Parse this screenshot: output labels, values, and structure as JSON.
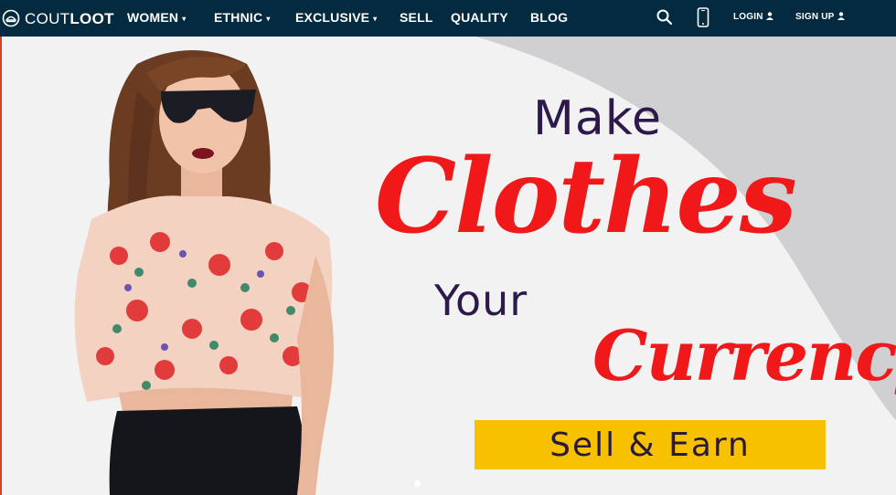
{
  "brand": {
    "thin": "COUT",
    "bold": "LOOT"
  },
  "nav": {
    "items": [
      {
        "label": "WOMEN",
        "caret": "▾"
      },
      {
        "label": "ETHNIC",
        "caret": "▾"
      },
      {
        "label": "EXCLUSIVE",
        "caret": "▾"
      },
      {
        "label": "SELL",
        "caret": ""
      },
      {
        "label": "QUALITY",
        "caret": ""
      },
      {
        "label": "BLOG",
        "caret": ""
      }
    ],
    "search_icon": "search-icon",
    "phone_icon": "mobile-phone-icon",
    "login": "LOGIN",
    "signup": "SIGN UP"
  },
  "hero": {
    "line1": "Make",
    "line2": "Clothes",
    "line3": "Your",
    "line4": "Currency",
    "cta": "Sell & Earn"
  },
  "carousel": {
    "active_index": 1,
    "count": 1
  },
  "colors": {
    "nav_bg": "#042a3f",
    "headline_red": "#f01818",
    "headline_purple": "#2d1a4a",
    "cta_bg": "#f7c100"
  }
}
